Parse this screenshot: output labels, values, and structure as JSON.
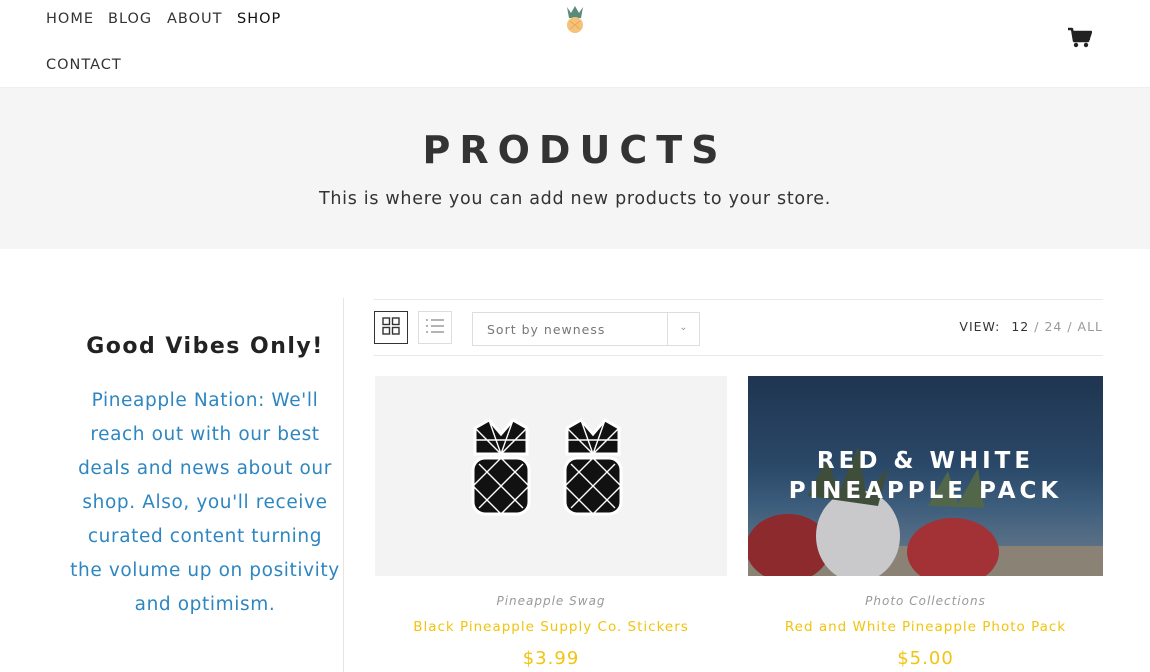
{
  "nav": {
    "items": [
      "HOME",
      "BLOG",
      "ABOUT",
      "SHOP",
      "CONTACT"
    ],
    "active": "SHOP"
  },
  "icons": {
    "logo": "pineapple-logo",
    "cart": "shopping-cart-icon",
    "grid": "grid-view-icon",
    "list": "list-view-icon",
    "sort_arrow": "chevron-down-icon"
  },
  "banner": {
    "title": "PRODUCTS",
    "subtitle": "This is where you can add new products to your store."
  },
  "sidebar": {
    "title": "Good Vibes Only!",
    "text": "Pineapple Nation: We'll reach out with our best deals and news about our shop. Also, you'll receive curated content turning the volume up on positivity and optimism."
  },
  "toolbar": {
    "sort_label": "Sort by newness",
    "view_label": "VIEW:",
    "view_options": [
      "12",
      "24",
      "ALL"
    ],
    "view_current": "12"
  },
  "products": [
    {
      "category": "Pineapple Swag",
      "name": "Black Pineapple Supply Co. Stickers",
      "price": "$3.99"
    },
    {
      "category": "Photo Collections",
      "name": "Red and White Pineapple Photo Pack",
      "price": "$5.00",
      "image_text": [
        "RED & WHITE",
        "PINEAPPLE PACK"
      ]
    }
  ],
  "colors": {
    "accent": "#f1c40f",
    "sidebar_text": "#2e86c1",
    "banner_bg": "#f5f5f5"
  }
}
